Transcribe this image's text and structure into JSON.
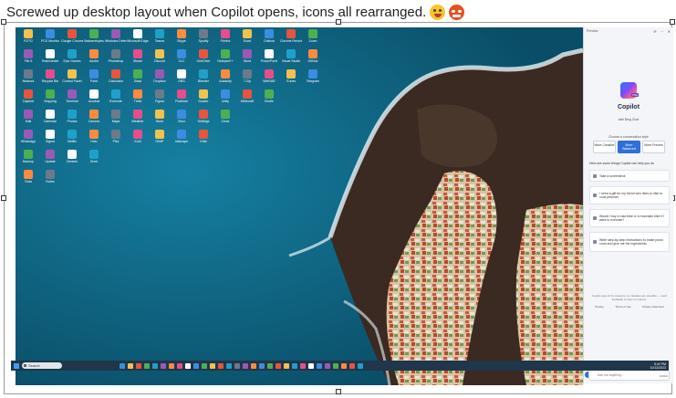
{
  "caption": {
    "text": "Screwed up desktop layout when Copilot opens, icons all rearranged.",
    "emojis": [
      "winking-tongue-face",
      "angry-face"
    ]
  },
  "desktop_icons": [
    "Fi2TG",
    "PCE Monitor",
    "Google Chrome",
    "Malwarebytes",
    "Windows Defender",
    "Microsoft Edge",
    "Teams",
    "Skype",
    "Spotify",
    "Firefox",
    "Excel",
    "Outlook",
    "Chrome Remote",
    "Zoom",
    "File 6",
    "Teamviewer",
    "Epic Games",
    "Adobe",
    "Photoshop",
    "Steam",
    "Discord",
    "VLC",
    "OneDrive",
    "Notepad++",
    "Word",
    "PowerPoint",
    "Visual Studio",
    "GitHub",
    "Network",
    "Recycle Bin",
    "Control Panel",
    "Paint",
    "Calculator",
    "Slack",
    "Dropbox",
    "OBS",
    "Blender",
    "Audacity",
    "7-Zip",
    "WinRAR",
    "iTunes",
    "Telegram",
    "Capture",
    "Snipping",
    "Terminal",
    "Acrobat",
    "Evernote",
    "Trello",
    "Figma",
    "Postman",
    "Docker",
    "Unity",
    "Minecraft",
    "Kindle",
    "Mail",
    "Calendar",
    "Photos",
    "Camera",
    "Maps",
    "Weather",
    "Store",
    "Xbox",
    "Settings",
    "Clock",
    "WhatsApp",
    "Signal",
    "Netflix",
    "Hulu",
    "Plex",
    "Kodi",
    "GIMP",
    "Inkscape",
    "Krita",
    "Backup",
    "Update",
    "Cleaner",
    "Drive",
    "Tools",
    "Notes"
  ],
  "taskbar": {
    "search_label": "Search",
    "time": "5:42 PM",
    "date": "10/13/2023"
  },
  "copilot": {
    "header_title": "Preview",
    "badge": "PRE",
    "title": "Copilot",
    "subtitle": "with Bing Chat",
    "choose_label": "Choose a conversation style",
    "styles": [
      {
        "label": "More Creative",
        "active": false
      },
      {
        "label": "More Balanced",
        "active": true
      },
      {
        "label": "More Precise",
        "active": false
      }
    ],
    "intro": "Here are some things Copilot can help you do",
    "suggestions": [
      "Take a screenshot",
      "I need a gift for my friend who likes to hike to cook prisoner",
      "Would I buy a road bike or a mountain bike if I want to exercise?",
      "Write step-by-step instructions to make pizza crust and give me the ingredients."
    ],
    "fine_print": "Copilot uses AI for answers, so mistakes are possible — send feedback to help us improve.",
    "links": [
      "Privacy",
      "Terms of use",
      "Privacy statement"
    ],
    "signin": "Sign in to ask more questions and have longer conversations",
    "input_placeholder": "Ask me anything...",
    "counter": "0/2000"
  }
}
